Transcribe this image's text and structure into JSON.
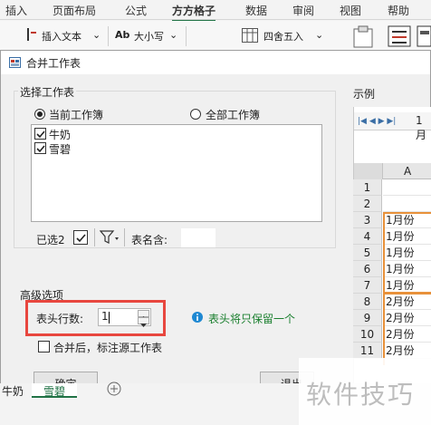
{
  "ribbon": {
    "tabs": [
      "插入",
      "页面布局",
      "公式",
      "方方格子",
      "数据",
      "审阅",
      "视图",
      "帮助"
    ],
    "active_tab": "方方格子",
    "tools": {
      "insert_text": "插入文本",
      "case": "大小写",
      "case_prefix": "Ab",
      "rounding": "四舍五入"
    }
  },
  "dialog": {
    "title": "合并工作表",
    "select_group": {
      "label": "选择工作表",
      "option_current": "当前工作簿",
      "option_all": "全部工作簿",
      "sheets": [
        {
          "name": "牛奶",
          "checked": true
        },
        {
          "name": "雪碧",
          "checked": true
        }
      ],
      "selected_count": "已选2",
      "table_name_label": "表名含:",
      "table_name_value": ""
    },
    "advanced_group": {
      "label": "高级选项",
      "header_rows_label": "表头行数:",
      "header_rows_value": "1",
      "hint": "表头将只保留一个",
      "mark_source_label": "合并后，标注源工作表",
      "mark_source_checked": false
    },
    "ok_button": "确定",
    "exit_button": "退出"
  },
  "preview": {
    "label": "示例",
    "sheet_tab": "1月",
    "column_header": "A",
    "rows": [
      {
        "num": "1",
        "value": ""
      },
      {
        "num": "2",
        "value": ""
      },
      {
        "num": "3",
        "value": "1月份"
      },
      {
        "num": "4",
        "value": "1月份"
      },
      {
        "num": "5",
        "value": "1月份"
      },
      {
        "num": "6",
        "value": "1月份"
      },
      {
        "num": "7",
        "value": "1月份"
      },
      {
        "num": "8",
        "value": "2月份"
      },
      {
        "num": "9",
        "value": "2月份"
      },
      {
        "num": "10",
        "value": "2月份"
      },
      {
        "num": "11",
        "value": "2月份"
      }
    ]
  },
  "sheet_tabs": [
    "牛奶",
    "雪碧"
  ],
  "watermark": "软件技巧",
  "colors": {
    "highlight_box": "#e8473f",
    "preview_outline": "#e8913a",
    "hint_icon": "#1e88d2",
    "hint_text": "#1a7f2e"
  }
}
